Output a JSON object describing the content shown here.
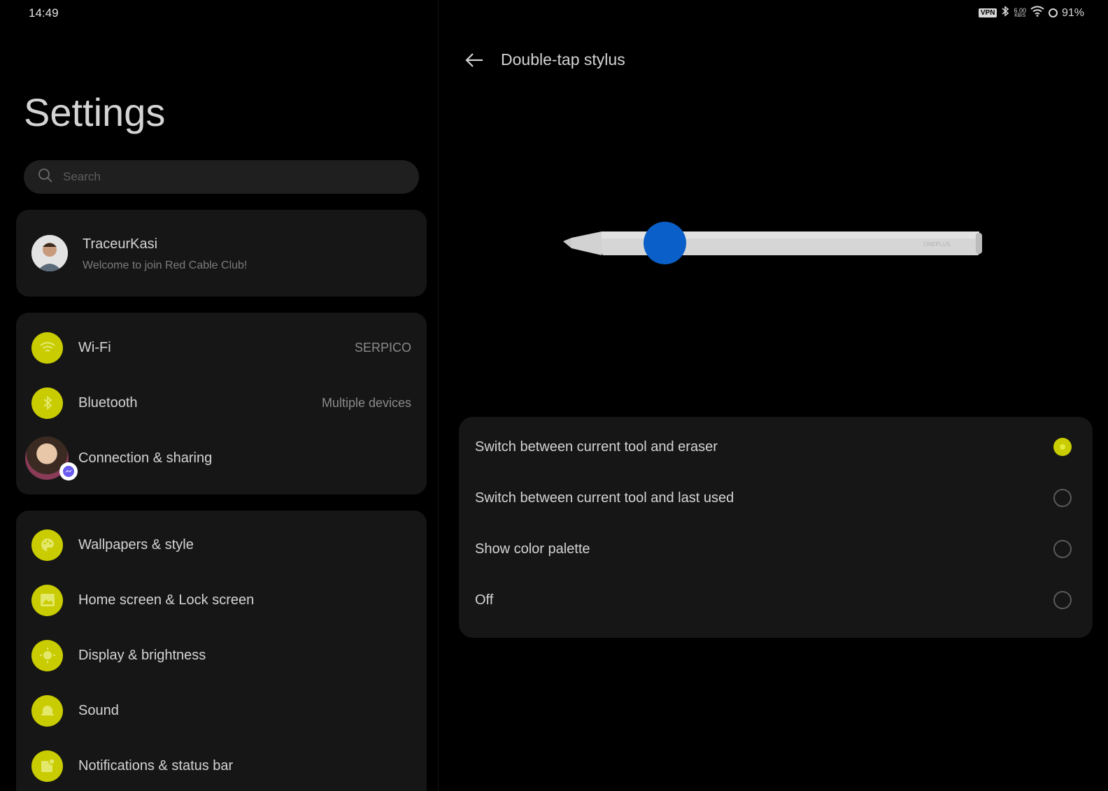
{
  "status_bar": {
    "time": "14:49",
    "vpn": "VPN",
    "speed_value": "6.00",
    "speed_unit": "KB/S",
    "battery": "91%"
  },
  "left_panel": {
    "title": "Settings",
    "search": {
      "placeholder": "Search"
    },
    "profile": {
      "name": "TraceurKasi",
      "subtitle": "Welcome to join Red Cable Club!"
    },
    "network_items": [
      {
        "label": "Wi-Fi",
        "value": "SERPICO",
        "icon": "wifi-icon"
      },
      {
        "label": "Bluetooth",
        "value": "Multiple devices",
        "icon": "bluetooth-icon"
      },
      {
        "label": "Connection & sharing",
        "value": "",
        "icon": "chat-bubble-avatar"
      }
    ],
    "display_items": [
      {
        "label": "Wallpapers & style",
        "icon": "palette-icon"
      },
      {
        "label": "Home screen & Lock screen",
        "icon": "image-icon"
      },
      {
        "label": "Display & brightness",
        "icon": "sun-icon"
      },
      {
        "label": "Sound",
        "icon": "bell-icon"
      },
      {
        "label": "Notifications & status bar",
        "icon": "notification-icon"
      }
    ]
  },
  "right_panel": {
    "title": "Double-tap stylus",
    "stylus_brand": "ONEPLUS",
    "options": [
      {
        "label": "Switch between current tool and eraser",
        "selected": true
      },
      {
        "label": "Switch between current tool and last used",
        "selected": false
      },
      {
        "label": "Show color palette",
        "selected": false
      },
      {
        "label": "Off",
        "selected": false
      }
    ]
  },
  "colors": {
    "accent": "#c8cc00",
    "touch_indicator": "#0b5fc9",
    "card_bg": "#161616",
    "background": "#000000"
  }
}
